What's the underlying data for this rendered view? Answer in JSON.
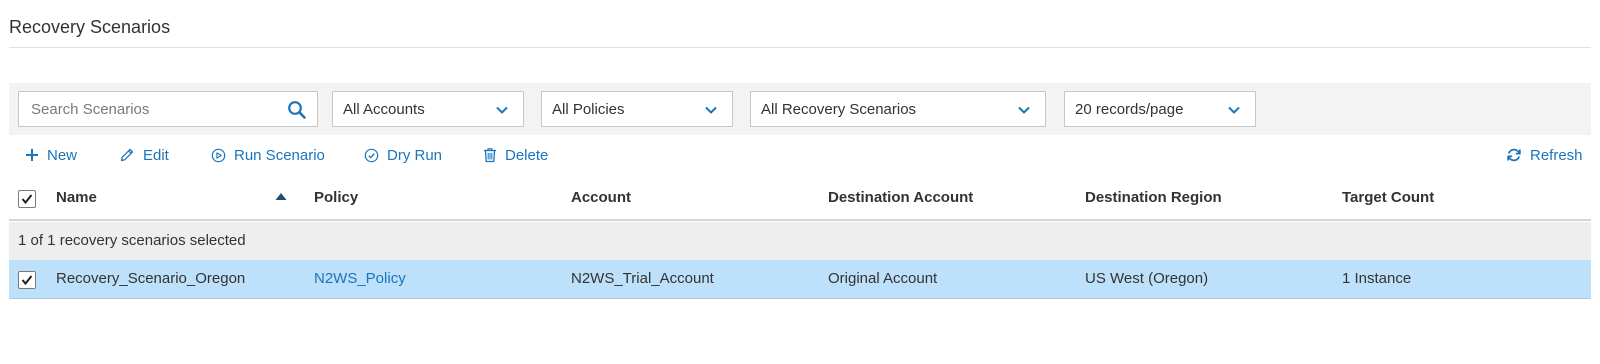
{
  "page": {
    "title": "Recovery Scenarios"
  },
  "filters": {
    "search_placeholder": "Search Scenarios",
    "search_value": "",
    "accounts": "All Accounts",
    "policies": "All Policies",
    "scenarios": "All Recovery Scenarios",
    "records_per_page": "20 records/page"
  },
  "toolbar": {
    "new": "New",
    "edit": "Edit",
    "run_scenario": "Run Scenario",
    "dry_run": "Dry Run",
    "delete": "Delete",
    "refresh": "Refresh"
  },
  "table": {
    "columns": [
      "Name",
      "Policy",
      "Account",
      "Destination Account",
      "Destination Region",
      "Target Count"
    ],
    "sort": {
      "column": "Name",
      "direction": "ascending"
    },
    "select_all_checked": true,
    "selection_text": "1 of 1 recovery scenarios selected",
    "rows": [
      {
        "checked": true,
        "name": "Recovery_Scenario_Oregon",
        "policy": "N2WS_Policy",
        "account": "N2WS_Trial_Account",
        "destination_account": "Original Account",
        "destination_region": "US West (Oregon)",
        "target_count": "1 Instance"
      }
    ]
  },
  "colors": {
    "accent": "#1b75bb",
    "selected_row": "#bde0fb",
    "filter_bar": "#f3f3f3"
  },
  "icons": {
    "search": "search-icon",
    "chevron": "chevron-down-icon",
    "new": "plus-icon",
    "edit": "pencil-icon",
    "run": "play-circle-icon",
    "dry_run": "check-circle-icon",
    "delete": "trash-icon",
    "refresh": "refresh-icon",
    "sort": "sort-ascending-icon",
    "check": "checkmark-icon"
  }
}
